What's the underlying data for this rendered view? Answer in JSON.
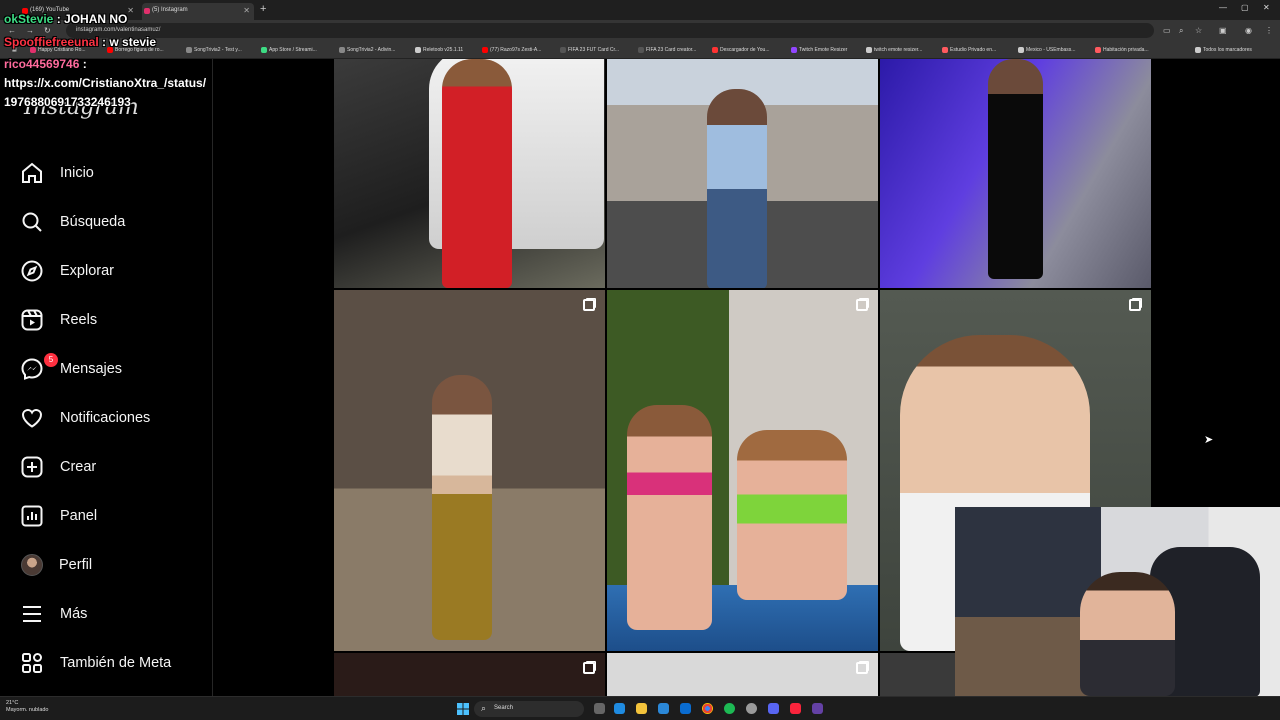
{
  "browser": {
    "tabs": [
      {
        "title": "(169) YouTube",
        "color": "#ff0000"
      },
      {
        "title": "(5) Instagram",
        "color": "#e1306c"
      }
    ],
    "url": "instagram.com/valentinasamuz/",
    "bookmarks": [
      {
        "label": "Happy Cristiano Ro...",
        "color": "#e1306c"
      },
      {
        "label": "Borrego figura de ro...",
        "color": "#ff0000"
      },
      {
        "label": "SongTrivia2 - Test y...",
        "color": "#888888"
      },
      {
        "label": "App Store / Streami...",
        "color": "#3ddc84"
      },
      {
        "label": "SongTrivia2 - Adivin...",
        "color": "#888888"
      },
      {
        "label": "Reletoob v25.1.11",
        "color": "#cccccc"
      },
      {
        "label": "(77) Razo97s Zesti-A...",
        "color": "#ff0000"
      },
      {
        "label": "FIFA 23 FUT Card Cr...",
        "color": "#444444"
      },
      {
        "label": "FIFA 23 Card creator...",
        "color": "#444444"
      },
      {
        "label": "Descargador de You...",
        "color": "#ff3333"
      },
      {
        "label": "Twitch Emote Resizer",
        "color": "#9146ff"
      },
      {
        "label": "twitch emote resizer...",
        "color": "#cccccc"
      },
      {
        "label": "Estudio Privado en...",
        "color": "#ff5a5f"
      },
      {
        "label": "Mexico - USEmbass...",
        "color": "#cccccc"
      },
      {
        "label": "Habitación privada...",
        "color": "#ff5a5f"
      },
      {
        "label": "Todos los marcadores",
        "color": "#cccccc"
      }
    ]
  },
  "chat": {
    "line1_user": "okStevie",
    "line1_msg": ": JOHAN NO",
    "line2_user": "Spooffiefreeunal",
    "line2_msg": ": w stevie",
    "line3_user": "rico44569746",
    "line3_msg": ":",
    "line4": "https://x.com/CristianoXtra_/status/",
    "line5": "1976880691733246193"
  },
  "sidebar": {
    "logo": "Instagram",
    "items": [
      {
        "label": "Inicio",
        "icon": "home-icon"
      },
      {
        "label": "Búsqueda",
        "icon": "search-icon"
      },
      {
        "label": "Explorar",
        "icon": "compass-icon"
      },
      {
        "label": "Reels",
        "icon": "reels-icon"
      },
      {
        "label": "Mensajes",
        "icon": "messenger-icon",
        "badge": "5"
      },
      {
        "label": "Notificaciones",
        "icon": "heart-icon"
      },
      {
        "label": "Crear",
        "icon": "plus-square-icon"
      },
      {
        "label": "Panel",
        "icon": "chart-icon"
      },
      {
        "label": "Perfil",
        "icon": "avatar"
      },
      {
        "label": "Más",
        "icon": "menu-icon"
      },
      {
        "label": "También de Meta",
        "icon": "meta-icon"
      }
    ]
  },
  "taskbar": {
    "weather_temp": "21°C",
    "weather_desc": "Mayorm. nublado",
    "search_placeholder": "Search"
  }
}
